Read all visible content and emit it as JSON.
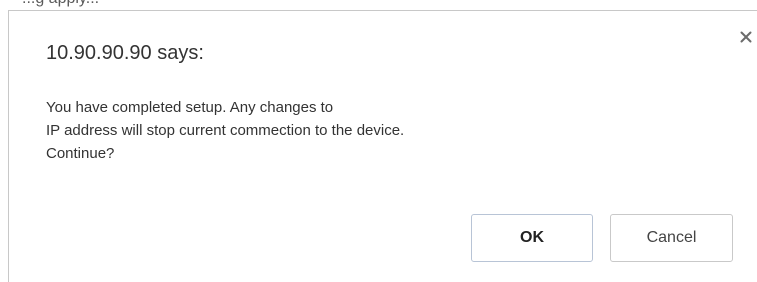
{
  "page": {
    "background_partial_text": "...g           apply..."
  },
  "dialog": {
    "title": "10.90.90.90 says:",
    "message_lines": [
      "You have completed setup. Any changes to",
      "IP address will stop current commection to the device.",
      "Continue?"
    ],
    "ok_label": "OK",
    "cancel_label": "Cancel",
    "close_icon": "close-icon"
  },
  "colors": {
    "text": "#333333",
    "button_border": "#c9c9c9",
    "ok_border": "#b8c4d6",
    "dialog_border": "#c8c8c8"
  }
}
